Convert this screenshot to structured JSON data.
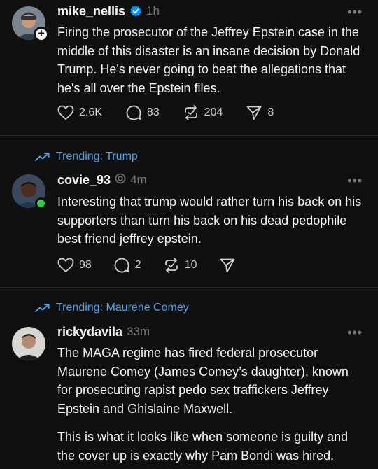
{
  "posts": [
    {
      "username": "mike_nellis",
      "time": "1h",
      "verified": true,
      "body": [
        "Firing the prosecutor of the Jeffrey Epstein case in the middle of this disaster is an insane decision by Donald Trump. He's never going to beat the allegations that he's all over the Epstein files."
      ],
      "likes": "2.6K",
      "replies": "83",
      "reposts": "204",
      "shares": "8",
      "more": "•••"
    },
    {
      "trending": "Trending: Trump",
      "username": "covie_93",
      "time": "4m",
      "body": [
        "Interesting that trump would rather turn his back on his supporters than turn his back on his dead pedophile best friend jeffrey epstein."
      ],
      "likes": "98",
      "replies": "2",
      "reposts": "10",
      "more": "•••"
    },
    {
      "trending": "Trending: Maurene Comey",
      "username": "rickydavila",
      "time": "33m",
      "body": [
        "The MAGA regime has fired federal prosecutor Maurene Comey (James Comey’s daughter), known for prosecuting rapist pedo sex traffickers Jeffrey Epstein and Ghislaine Maxwell.",
        "This is what it looks like when someone is guilty and the cover up is exactly why Pam Bondi was hired."
      ],
      "more": "•••"
    }
  ],
  "colors": {
    "background": "#101010",
    "text": "#f3f5f7",
    "muted": "#777777",
    "trending": "#4aa3f0",
    "verified": "#0095f6",
    "online": "#2fcf45"
  }
}
